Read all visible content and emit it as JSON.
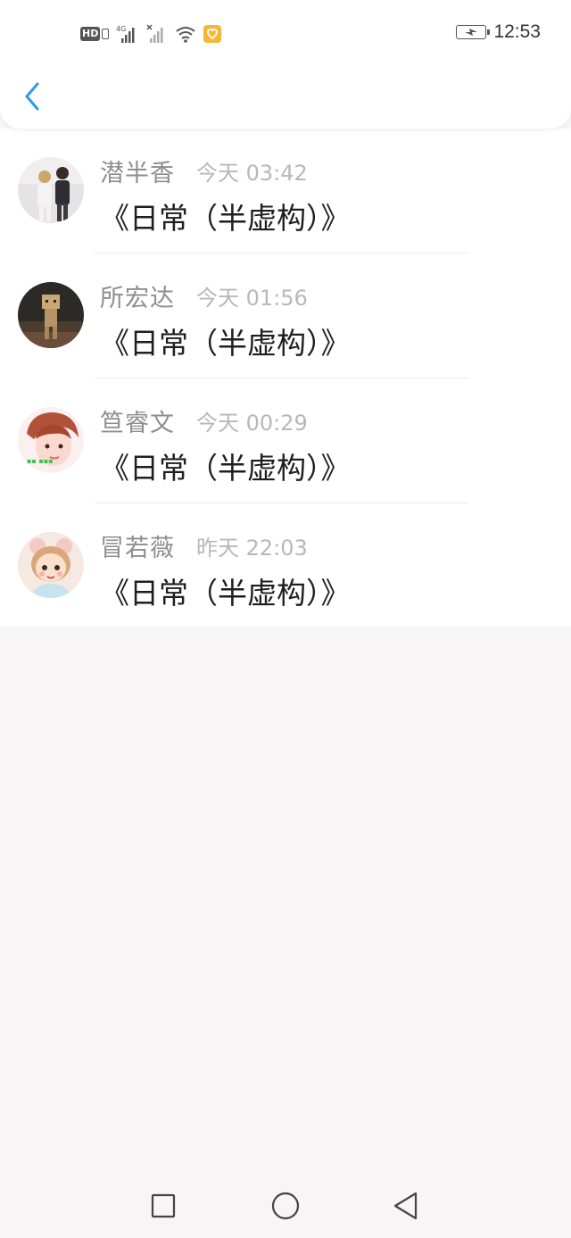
{
  "status_bar": {
    "network_type": "4G",
    "time": "12:53",
    "icons": [
      "hd-icon",
      "signal-4g-icon",
      "signal-no-service-icon",
      "wifi-icon",
      "notification-app-icon",
      "battery-charging-icon"
    ]
  },
  "header": {
    "back_icon": "chevron-left-icon"
  },
  "list": {
    "items": [
      {
        "author": "潜半香",
        "time": "今天 03:42",
        "title": "《日常（半虚构）》"
      },
      {
        "author": "所宏达",
        "time": "今天 01:56",
        "title": "《日常（半虚构）》"
      },
      {
        "author": "笪睿文",
        "time": "今天 00:29",
        "title": "《日常（半虚构）》"
      },
      {
        "author": "冒若薇",
        "time": "昨天 22:03",
        "title": "《日常（半虚构）》"
      }
    ]
  },
  "nav_bar": {
    "icons": [
      "square-recent-apps-icon",
      "circle-home-icon",
      "triangle-back-icon"
    ]
  },
  "colors": {
    "accent": "#2b9be6",
    "author_text": "#8e8e8e",
    "time_text": "#b8b8b8",
    "title_text": "#1f1f1f",
    "background": "#f8f6f7"
  }
}
